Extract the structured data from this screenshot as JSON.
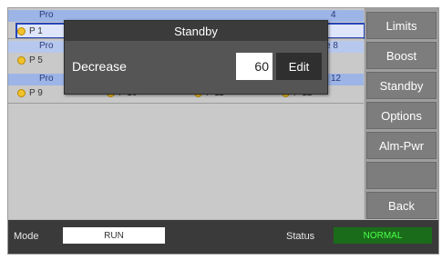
{
  "dialog": {
    "title": "Standby",
    "label": "Decrease",
    "value": "60",
    "edit_label": "Edit"
  },
  "rows": [
    {
      "band_labels": [
        "Pro",
        "4"
      ],
      "zones": [
        "P 1"
      ]
    },
    {
      "band_labels": [
        "Pro",
        "e 8"
      ],
      "zones": [
        "P 5"
      ]
    },
    {
      "band_labels": [
        "Pro",
        "12"
      ],
      "zones": [
        "P 9",
        "P 10",
        "P 11",
        "P 12"
      ]
    }
  ],
  "sidebar": {
    "buttons": [
      "Limits",
      "Boost",
      "Standby",
      "Options",
      "Alm-Pwr",
      "",
      "Back"
    ]
  },
  "statusbar": {
    "mode_label": "Mode",
    "mode_value": "RUN",
    "status_label": "Status",
    "status_value": "NORMAL"
  }
}
